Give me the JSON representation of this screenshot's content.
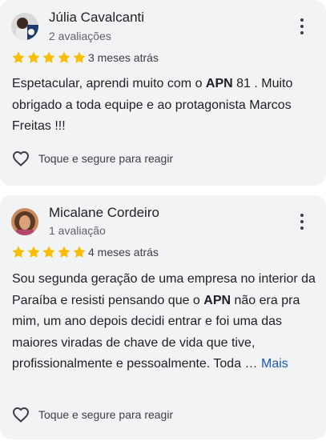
{
  "reviews": [
    {
      "name": "Júlia Cavalcanti",
      "count": "2 avaliações",
      "rating": 5,
      "time": "3 meses atrás",
      "text": {
        "p1": "Espetacular, aprendi muito com o ",
        "b1": "APN",
        "p2": " 81 . Muito obrigado a toda equipe e ao protagonista Marcos Freitas !!!"
      },
      "react_label": "Toque e segure para reagir"
    },
    {
      "name": "Micalane Cordeiro",
      "count": "1 avaliação",
      "rating": 5,
      "time": "4 meses atrás",
      "text": {
        "p1": "Sou segunda geração de uma empresa no interior da Paraíba e resisti pensando que o ",
        "b1": "APN",
        "p2": " não era pra mim, um ano depois decidi entrar e foi uma das maiores viradas de chave de vida que tive, profissionalmente e pessoalmente. Toda … "
      },
      "more_label": "Mais",
      "react_label": "Toque e segure para reagir"
    }
  ],
  "colors": {
    "card_bg": "#f1f3f4",
    "star": "#fbbc04",
    "link": "#1a56c5"
  },
  "icons": [
    "avatar",
    "more-vert-icon",
    "star-icon",
    "heart-outline-icon"
  ]
}
